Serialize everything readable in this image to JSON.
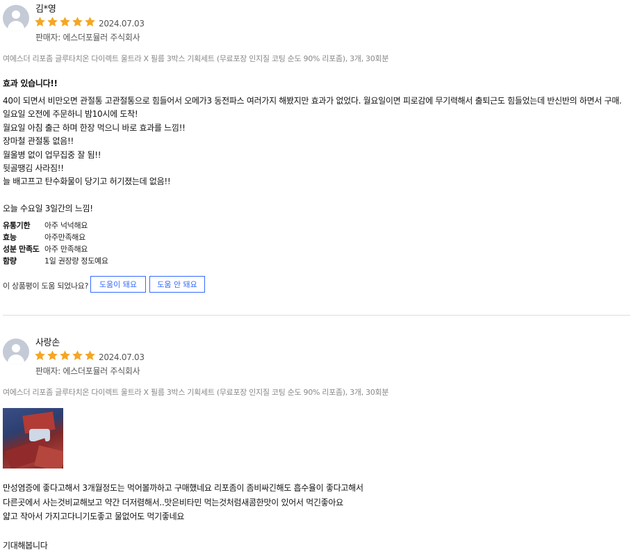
{
  "colors": {
    "star": "#f5a623",
    "accent": "#346aff",
    "avatar": "#c4cbd6"
  },
  "reviews": [
    {
      "username": "김*영",
      "rating": 5,
      "date": "2024.07.03",
      "seller": "판매자: 에스더포뮬러 주식회사",
      "product": "여에스더 리포좀 글루타치온 다이렉트 울트라 X 필름 3박스 기획세트 (무료포장 인지질 코팅 순도 90% 리포좀), 3개, 30회분",
      "headline": "효과 있습니다!!",
      "lines": [
        "40이 되면서 비만오면 관절통 고관절통으로 힘들어서 오메가3 동전파스 여러가지 해봤지만 효과가 없었다. 월요일이면 피로감에 무기력해서 출퇴근도 힘들었는데 반신반의 하면서 구매.",
        "일요일 오전에 주문하니 밤10시에 도착!",
        "월요일 아침 출근 하며 한장 먹으니 바로 효과를 느낌!!",
        "장마철 관절통 없음!!",
        "월울병 없이 업무집중 잘 됨!!",
        "뒷골땡김 사라짐!!",
        "늘 배고프고 탄수화물이 당기고 허기졌는데 없음!!",
        "",
        "오늘 수요일 3일간의 느낌!"
      ],
      "survey": [
        {
          "q": "유통기한",
          "a": "아주 넉넉해요"
        },
        {
          "q": "효능",
          "a": "아주만족해요"
        },
        {
          "q": "성분 만족도",
          "a": "아주 만족해요"
        },
        {
          "q": "함량",
          "a": "1일 권장량 정도예요"
        }
      ],
      "helpful_question": "이 상품평이 도움 되었나요?",
      "helpful_yes": "도움이 돼요",
      "helpful_no": "도움 안 돼요"
    },
    {
      "username": "사랑손",
      "rating": 5,
      "date": "2024.07.03",
      "seller": "판매자: 에스더포뮬러 주식회사",
      "product": "여에스더 리포좀 글루타치온 다이렉트 울트라 X 필름 3박스 기획세트 (무료포장 인지질 코팅 순도 90% 리포좀), 3개, 30회분",
      "lines": [
        "만성염증에 좋다고해서 3개월정도는 먹어볼까하고 구매했네요 리포좀이 좀비싸긴해도 흡수율이 좋다고해서",
        "다른곳에서 사는것비교해보고 약간 더저렴해서..맛은비타민 먹는것처럼새콤한맛이 있어서 먹긴좋아요",
        "얇고 작아서 가지고다니기도좋고 물없어도 먹기좋네요",
        "",
        "기대해봅니다"
      ]
    }
  ]
}
